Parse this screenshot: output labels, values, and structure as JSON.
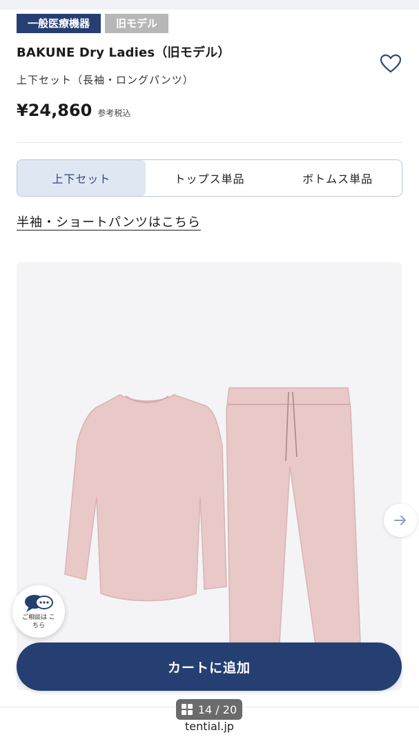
{
  "badges": {
    "medical": "一般医療機器",
    "model": "旧モデル"
  },
  "product": {
    "title": "BAKUNE Dry Ladies（旧モデル）",
    "subtitle": "上下セット（長袖・ロングパンツ）",
    "price": "¥24,860",
    "tax_note": "参考税込"
  },
  "tabs": [
    {
      "label": "上下セット",
      "active": true
    },
    {
      "label": "トップス単品",
      "active": false
    },
    {
      "label": "ボトムス単品",
      "active": false
    }
  ],
  "links": {
    "short_sleeve": "半袖・ショートパンツはこちら"
  },
  "consult": {
    "label": "ご相談は こちら"
  },
  "cart": {
    "label": "カートに追加"
  },
  "pager": {
    "text": "14 / 20"
  },
  "footer": {
    "domain": "tential.jp"
  },
  "colors": {
    "brand_navy": "#253f73",
    "badge_gray": "#b7b7b7",
    "active_tab_bg": "#dfe7f3",
    "product_pink": "#e8c9c7"
  },
  "icons": {
    "favorite": "heart-icon",
    "next": "arrow-right-icon",
    "consult": "chat-bubbles-icon",
    "pager": "grid-icon"
  }
}
